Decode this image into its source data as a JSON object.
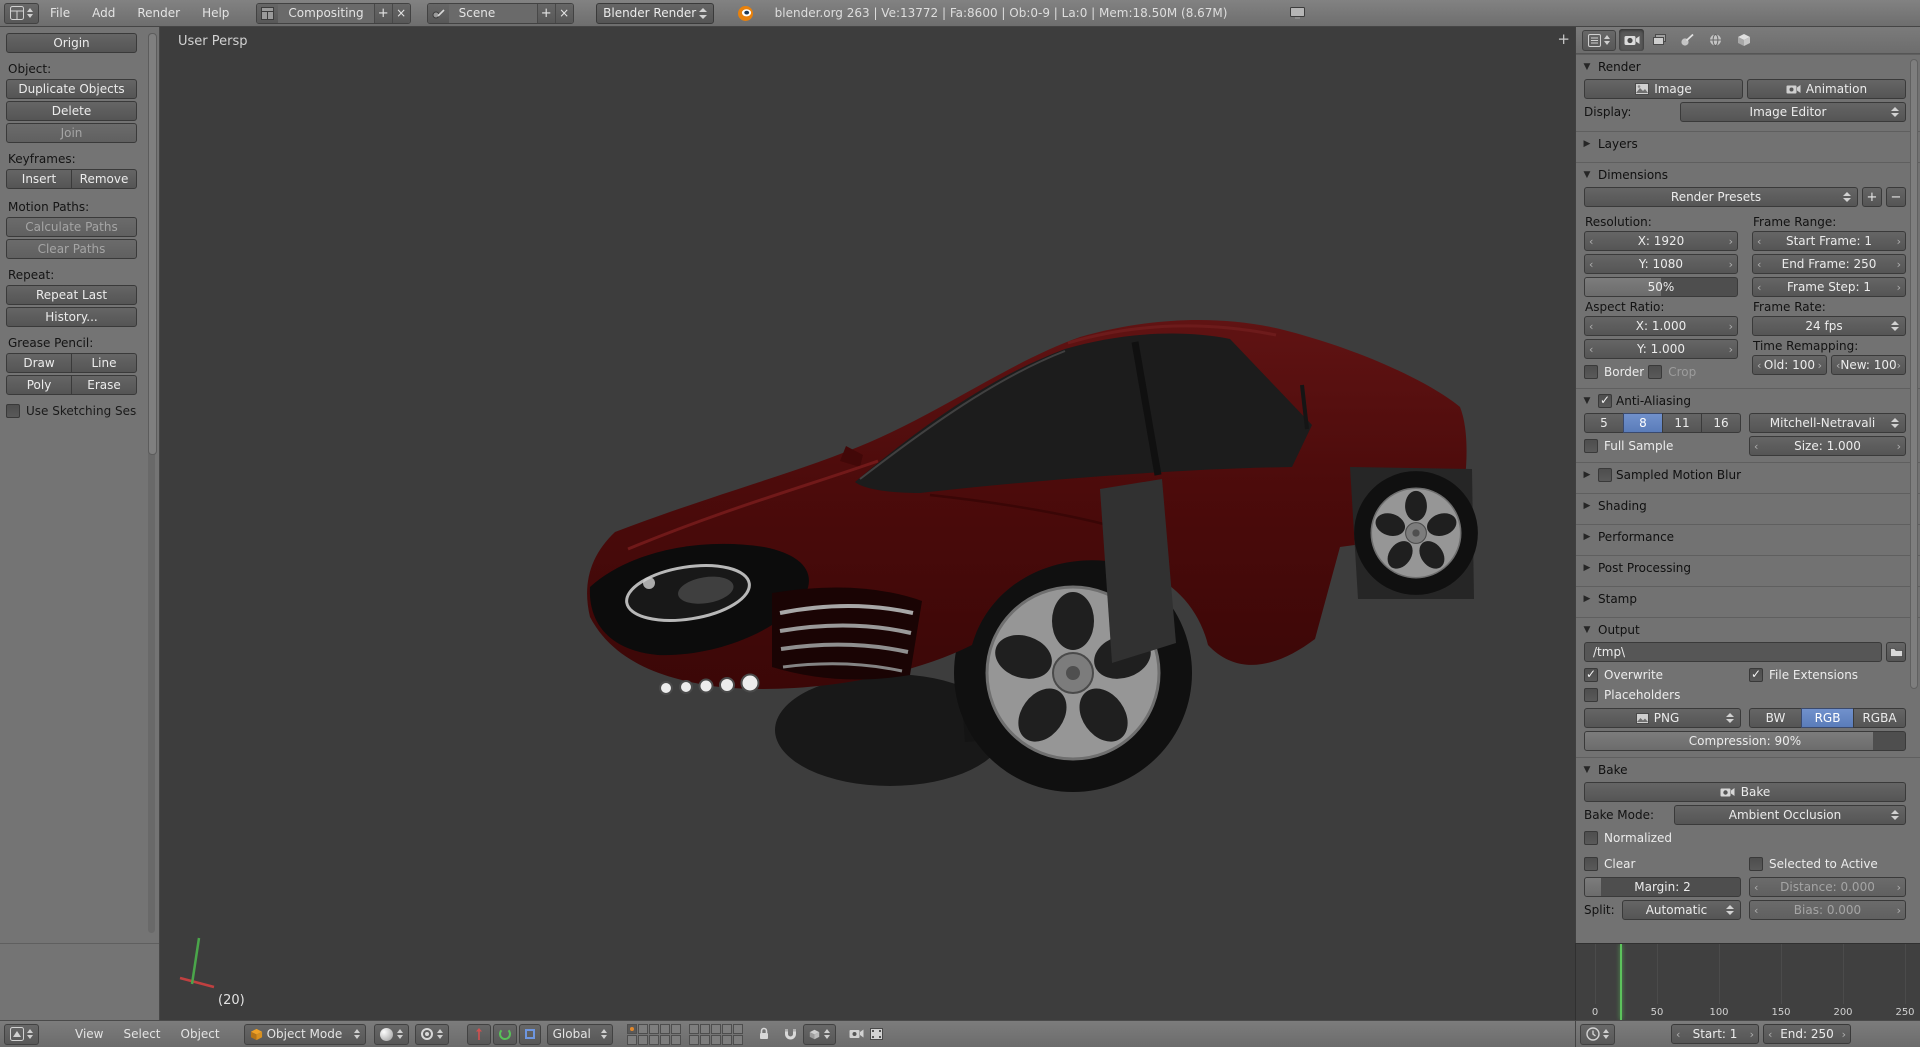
{
  "colors": {
    "accent_blue": "#5f82b8",
    "viewport_bg": "#3d3d3d",
    "panel_bg": "#727272",
    "car_body": "#4c0b0b",
    "playhead_green": "#5cc35c"
  },
  "top_header": {
    "menus": [
      "File",
      "Add",
      "Render",
      "Help"
    ],
    "layout_name": "Compositing",
    "scene_name": "Scene",
    "engine": "Blender Render",
    "info": "blender.org 263 | Ve:13772 | Fa:8600 | Ob:0-9 | La:0 | Mem:18.50M (8.67M)"
  },
  "tool_shelf": {
    "origin": "Origin",
    "object_label": "Object:",
    "duplicate": "Duplicate Objects",
    "delete": "Delete",
    "join": "Join",
    "keyframes_label": "Keyframes:",
    "insert": "Insert",
    "remove": "Remove",
    "motion_paths_label": "Motion Paths:",
    "calculate_paths": "Calculate Paths",
    "clear_paths": "Clear Paths",
    "repeat_label": "Repeat:",
    "repeat_last": "Repeat Last",
    "history": "History...",
    "grease_pencil_label": "Grease Pencil:",
    "draw": "Draw",
    "line": "Line",
    "poly": "Poly",
    "erase": "Erase",
    "use_sketching": "Use Sketching Sessio"
  },
  "viewport": {
    "view_label": "User Persp",
    "frame_indicator": "(20)"
  },
  "properties": {
    "render_panel": {
      "title": "Render",
      "image_button": "Image",
      "animation_button": "Animation",
      "display_label": "Display:",
      "display_value": "Image Editor"
    },
    "layers_panel": {
      "title": "Layers"
    },
    "dimensions_panel": {
      "title": "Dimensions",
      "presets": "Render Presets",
      "resolution_label": "Resolution:",
      "res_x": "X: 1920",
      "res_y": "Y: 1080",
      "res_percent": "50%",
      "aspect_label": "Aspect Ratio:",
      "aspect_x": "X: 1.000",
      "aspect_y": "Y: 1.000",
      "border": "Border",
      "crop": "Crop",
      "frame_range_label": "Frame Range:",
      "start_frame": "Start Frame: 1",
      "end_frame": "End Frame: 250",
      "frame_step": "Frame Step: 1",
      "frame_rate_label": "Frame Rate:",
      "fps": "24 fps",
      "time_remap_label": "Time Remapping:",
      "old": "Old: 100",
      "new": "New: 100"
    },
    "aa_panel": {
      "title": "Anti-Aliasing",
      "samples": [
        "5",
        "8",
        "11",
        "16"
      ],
      "selected_sample": "8",
      "filter": "Mitchell-Netravali",
      "full_sample": "Full Sample",
      "size": "Size: 1.000"
    },
    "motion_blur_panel": {
      "title": "Sampled Motion Blur"
    },
    "shading_panel": {
      "title": "Shading"
    },
    "performance_panel": {
      "title": "Performance"
    },
    "post_processing_panel": {
      "title": "Post Processing"
    },
    "stamp_panel": {
      "title": "Stamp"
    },
    "output_panel": {
      "title": "Output",
      "path": "/tmp\\",
      "overwrite": "Overwrite",
      "file_extensions": "File Extensions",
      "placeholders": "Placeholders",
      "format": "PNG",
      "bw": "BW",
      "rgb": "RGB",
      "rgba": "RGBA",
      "compression": "Compression: 90%",
      "compression_percent": 90
    },
    "bake_panel": {
      "title": "Bake",
      "bake_button": "Bake",
      "bake_mode_label": "Bake Mode:",
      "bake_mode": "Ambient Occlusion",
      "normalized": "Normalized",
      "clear": "Clear",
      "selected_to_active": "Selected to Active",
      "margin": "Margin: 2",
      "distance": "Distance: 0.000",
      "split_label": "Split:",
      "split": "Automatic",
      "bias": "Bias: 0.000"
    }
  },
  "timeline": {
    "ticks": [
      "0",
      "50",
      "100",
      "150",
      "200",
      "250"
    ],
    "start_field": "Start: 1",
    "end_field": "End: 250",
    "current_frame": 20
  },
  "viewport_header": {
    "menus": [
      "View",
      "Select",
      "Object"
    ],
    "mode": "Object Mode",
    "orientation": "Global"
  }
}
